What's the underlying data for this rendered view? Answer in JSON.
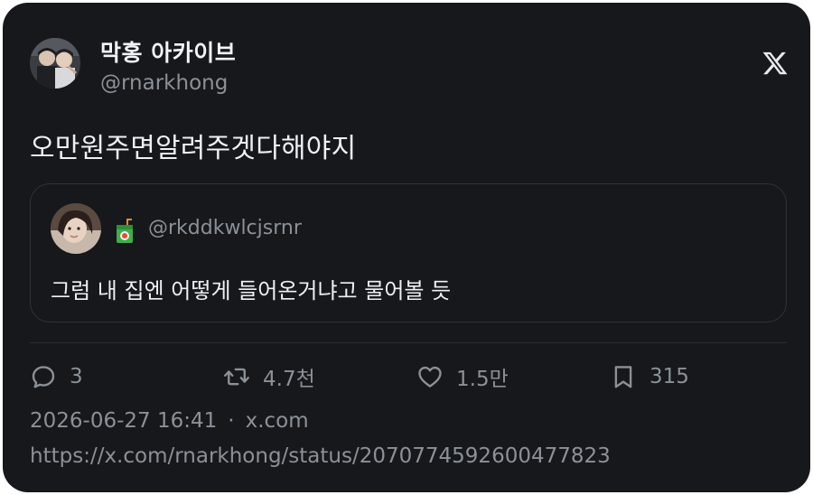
{
  "author": {
    "display_name": "막홍 아카이브",
    "handle": "@rnarkhong"
  },
  "tweet": {
    "text": "오만원주면알려주겟다해야지"
  },
  "quoted": {
    "handle": "@rkddkwlcjsrnr",
    "text": "그럼 내 집엔 어떻게 들어온거냐고 물어볼 듯"
  },
  "stats": {
    "replies": "3",
    "retweets": "4.7천",
    "likes": "1.5만",
    "bookmarks": "315"
  },
  "meta": {
    "timestamp": "2026-06-27 16:41",
    "separator": "·",
    "source": "x.com",
    "url": "https://x.com/rnarkhong/status/2070774592600477823"
  },
  "icons": {
    "brand": "x-logo-icon",
    "reply": "reply-icon",
    "retweet": "retweet-icon",
    "like": "heart-icon",
    "bookmark": "bookmark-icon",
    "quote_badge": "juice-box-emoji"
  },
  "colors": {
    "card_bg": "#16181c",
    "text_primary": "#e7e9ea",
    "text_secondary": "#8b9197",
    "border": "#2f3336"
  }
}
